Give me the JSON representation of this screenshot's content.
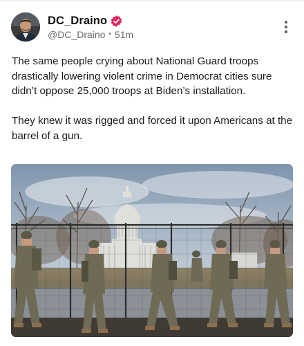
{
  "author": {
    "display_name": "DC_Draino",
    "handle": "@DC_Draino",
    "time_ago": "51m",
    "verified_badge_color": "#e0245e"
  },
  "post": {
    "paragraphs": [
      "The same people crying about National Guard troops drastically lowering violent crime in Democrat cities sure didn’t oppose 25,000 troops at Biden’s installation.",
      "They knew it was rigged and forced it upon Americans at the barrel of a gun."
    ]
  },
  "icons": {
    "verified": "verified-badge-icon",
    "more": "more-vertical-icon"
  },
  "media": {
    "subject": "Soldiers in camouflage walking along a fence in front of the U.S. Capitol dome"
  }
}
